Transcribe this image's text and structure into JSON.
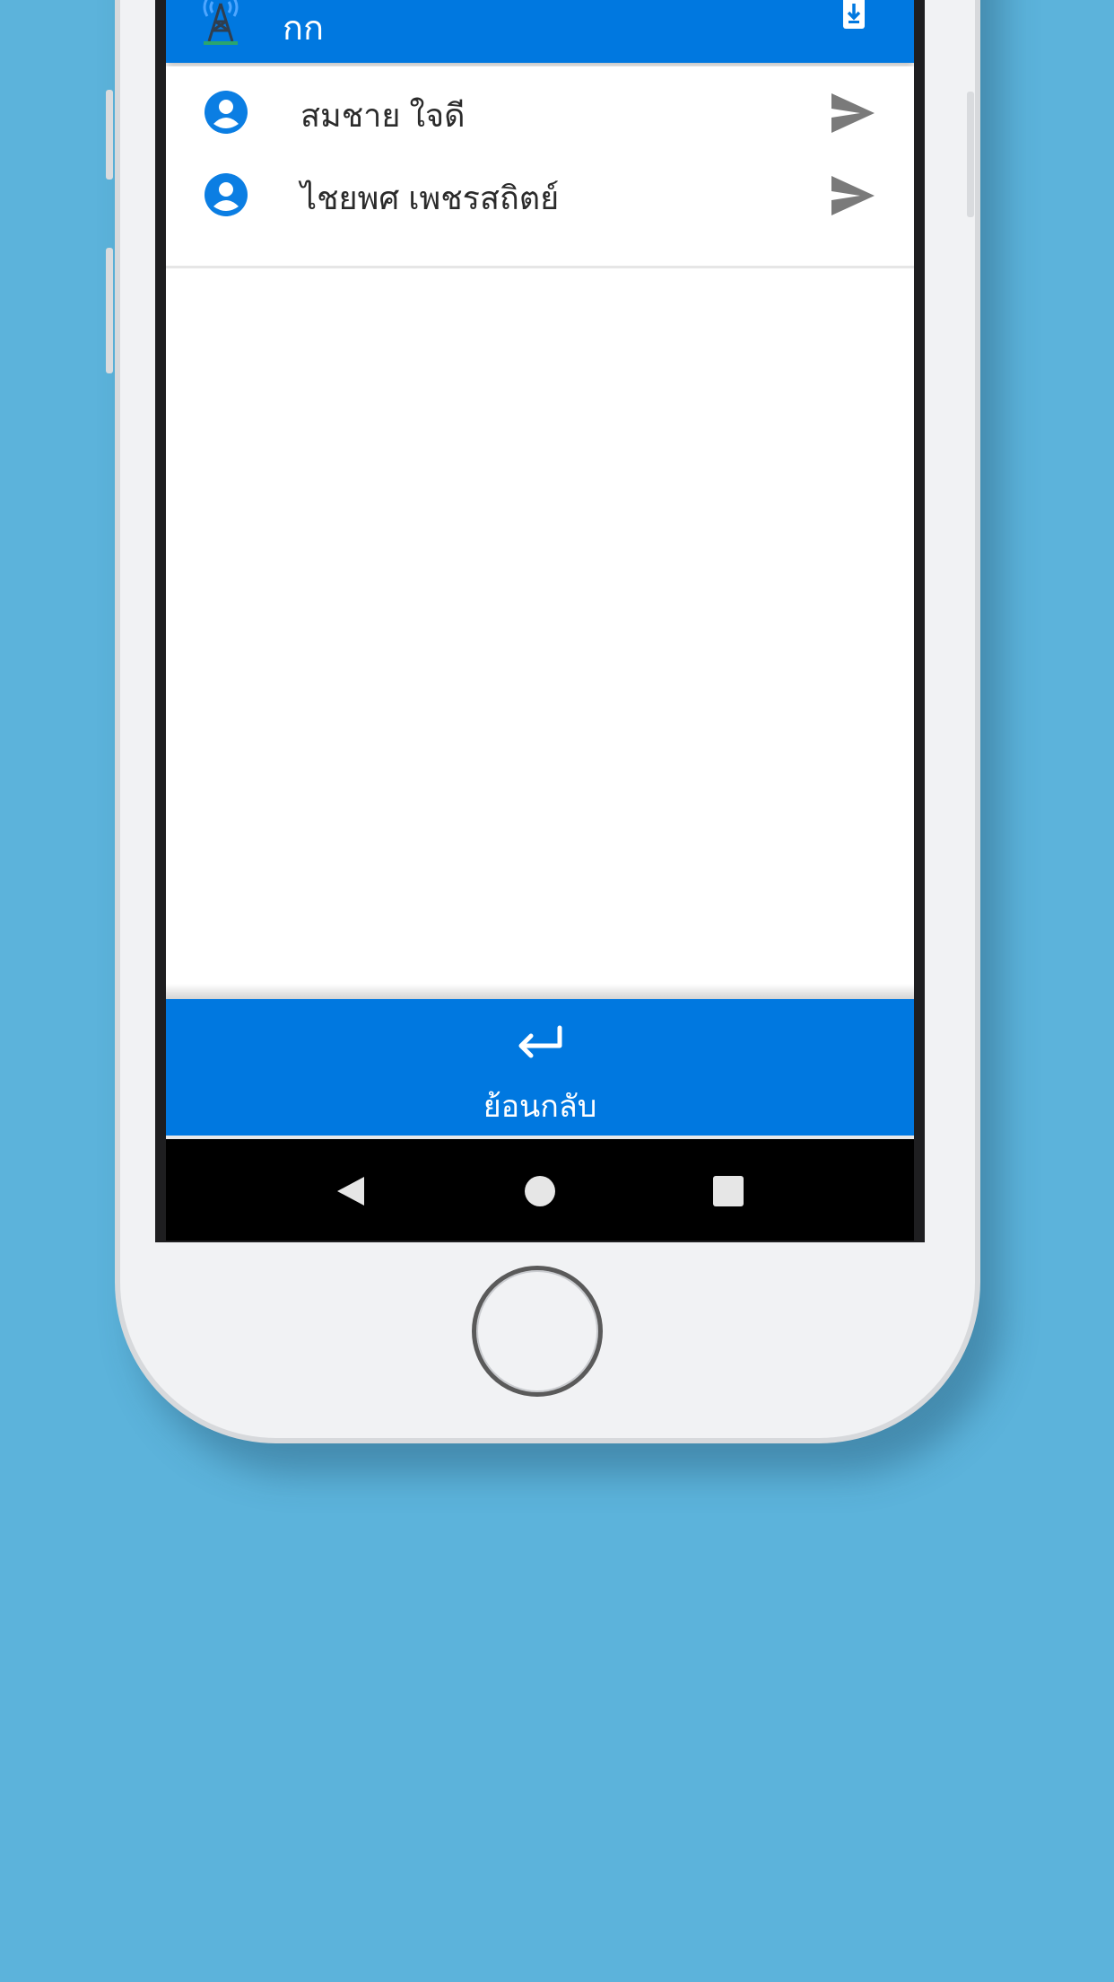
{
  "app": {
    "title": "กก",
    "colors": {
      "primary": "#0078e0",
      "background": "#5cb3db",
      "icon_gray": "#7a7a7a"
    }
  },
  "header": {
    "logo_icon": "radio-tower-icon",
    "download_icon": "download-phone-icon"
  },
  "contacts": [
    {
      "name": "สมชาย ใจดี",
      "icon": "account-circle-icon",
      "action_icon": "send-icon"
    },
    {
      "name": "ไชยพศ เพชรสถิตย์",
      "icon": "account-circle-icon",
      "action_icon": "send-icon"
    }
  ],
  "footer": {
    "back_label": "ย้อนกลับ",
    "back_icon": "return-arrow-icon"
  },
  "system_nav": [
    "back-triangle-icon",
    "home-circle-icon",
    "recents-square-icon"
  ]
}
